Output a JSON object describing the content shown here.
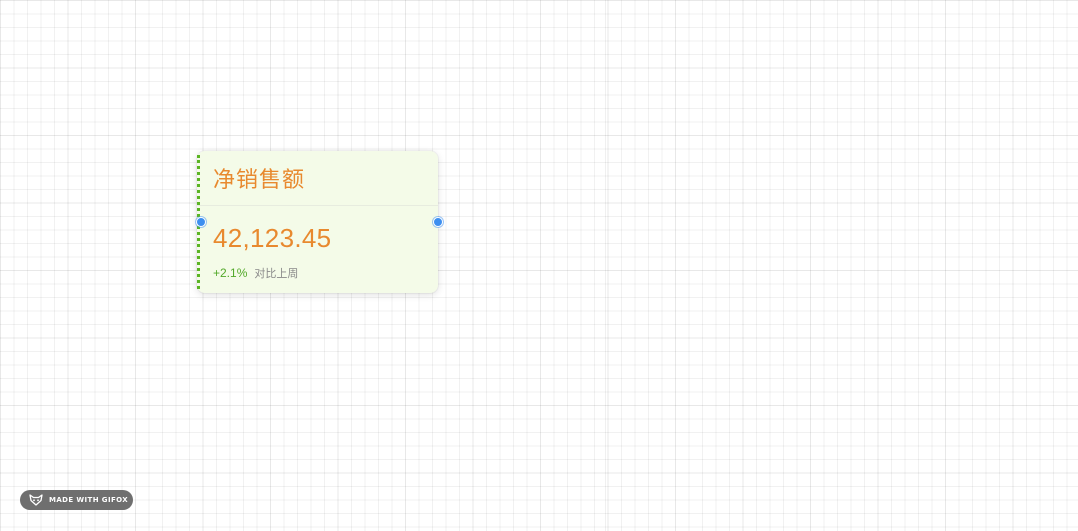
{
  "card": {
    "title": "净销售额",
    "value": "42,123.45",
    "delta": "+2.1%",
    "compare_label": "对比上周",
    "colors": {
      "background": "#f4fbe8",
      "title": "#e8892e",
      "value": "#e8892e",
      "delta": "#52a829",
      "edge": "#5bb524",
      "handle": "#3d8ff0"
    }
  },
  "watermark": {
    "icon": "fox-icon",
    "text": "MADE WITH GIFOX"
  }
}
